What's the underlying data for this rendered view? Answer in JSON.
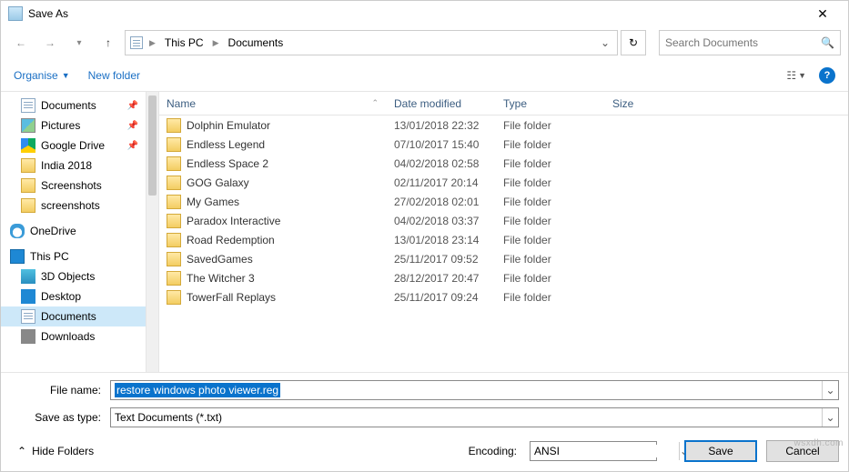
{
  "title": "Save As",
  "breadcrumb": {
    "root": "This PC",
    "current": "Documents"
  },
  "search": {
    "placeholder": "Search Documents"
  },
  "toolbar": {
    "organise": "Organise",
    "newfolder": "New folder"
  },
  "columns": {
    "name": "Name",
    "date": "Date modified",
    "type": "Type",
    "size": "Size"
  },
  "tree": {
    "documents": "Documents",
    "pictures": "Pictures",
    "gdrive": "Google Drive",
    "india": "India 2018",
    "screenshots1": "Screenshots",
    "screenshots2": "screenshots",
    "onedrive": "OneDrive",
    "thispc": "This PC",
    "objects3d": "3D Objects",
    "desktop": "Desktop",
    "documents2": "Documents",
    "downloads": "Downloads"
  },
  "files": [
    {
      "name": "Dolphin Emulator",
      "date": "13/01/2018 22:32",
      "type": "File folder"
    },
    {
      "name": "Endless Legend",
      "date": "07/10/2017 15:40",
      "type": "File folder"
    },
    {
      "name": "Endless Space 2",
      "date": "04/02/2018 02:58",
      "type": "File folder"
    },
    {
      "name": "GOG Galaxy",
      "date": "02/11/2017 20:14",
      "type": "File folder"
    },
    {
      "name": "My Games",
      "date": "27/02/2018 02:01",
      "type": "File folder"
    },
    {
      "name": "Paradox Interactive",
      "date": "04/02/2018 03:37",
      "type": "File folder"
    },
    {
      "name": "Road Redemption",
      "date": "13/01/2018 23:14",
      "type": "File folder"
    },
    {
      "name": "SavedGames",
      "date": "25/11/2017 09:52",
      "type": "File folder"
    },
    {
      "name": "The Witcher 3",
      "date": "28/12/2017 20:47",
      "type": "File folder"
    },
    {
      "name": "TowerFall Replays",
      "date": "25/11/2017 09:24",
      "type": "File folder"
    }
  ],
  "form": {
    "filename_label": "File name:",
    "filename_value": "restore windows photo viewer.reg",
    "type_label": "Save as type:",
    "type_value": "Text Documents (*.txt)",
    "encoding_label": "Encoding:",
    "encoding_value": "ANSI",
    "save": "Save",
    "cancel": "Cancel",
    "hide": "Hide Folders"
  },
  "watermark": "wsxdh.com"
}
